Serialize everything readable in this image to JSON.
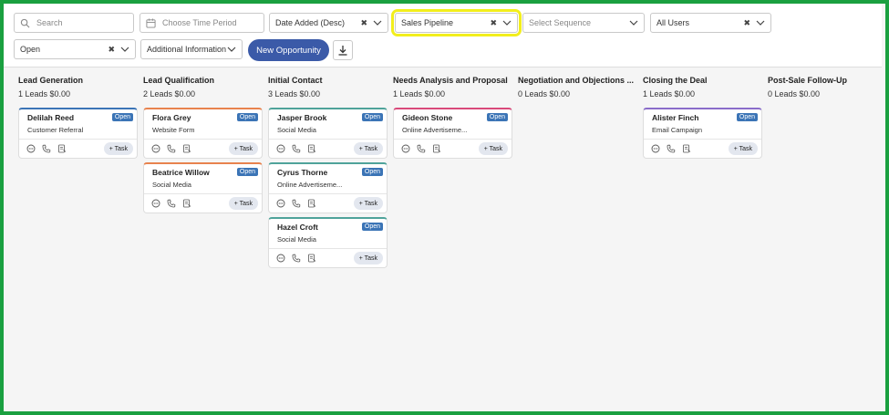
{
  "filters": {
    "search_placeholder": "Search",
    "time_period_placeholder": "Choose Time Period",
    "sort_value": "Date Added (Desc)",
    "pipeline_value": "Sales Pipeline",
    "sequence_placeholder": "Select Sequence",
    "users_value": "All Users",
    "status_value": "Open",
    "additional_info": "Additional Information"
  },
  "actions": {
    "new_opportunity": "New Opportunity"
  },
  "columns": [
    {
      "title": "Lead Generation",
      "summary": "1 Leads $0.00",
      "cards": [
        {
          "name": "Delilah Reed",
          "source": "Customer Referral",
          "status": "Open",
          "task": "+ Task",
          "accent": "#3b74b6"
        }
      ]
    },
    {
      "title": "Lead Qualification",
      "summary": "2 Leads $0.00",
      "cards": [
        {
          "name": "Flora Grey",
          "source": "Website Form",
          "status": "Open",
          "task": "+ Task",
          "accent": "#e8834e"
        },
        {
          "name": "Beatrice Willow",
          "source": "Social Media",
          "status": "Open",
          "task": "+ Task",
          "accent": "#e8834e"
        }
      ]
    },
    {
      "title": "Initial Contact",
      "summary": "3 Leads $0.00",
      "cards": [
        {
          "name": "Jasper Brook",
          "source": "Social Media",
          "status": "Open",
          "task": "+ Task",
          "accent": "#4fa39a"
        },
        {
          "name": "Cyrus Thorne",
          "source": "Online Advertiseme...",
          "status": "Open",
          "task": "+ Task",
          "accent": "#4fa39a"
        },
        {
          "name": "Hazel Croft",
          "source": "Social Media",
          "status": "Open",
          "task": "+ Task",
          "accent": "#4fa39a"
        }
      ]
    },
    {
      "title": "Needs Analysis and Proposal",
      "summary": "1 Leads $0.00",
      "cards": [
        {
          "name": "Gideon Stone",
          "source": "Online Advertiseme...",
          "status": "Open",
          "task": "+ Task",
          "accent": "#d9497a"
        }
      ]
    },
    {
      "title": "Negotiation and Objections ...",
      "summary": "0 Leads $0.00",
      "cards": []
    },
    {
      "title": "Closing the Deal",
      "summary": "1 Leads $0.00",
      "cards": [
        {
          "name": "Alister Finch",
          "source": "Email Campaign",
          "status": "Open",
          "task": "+ Task",
          "accent": "#8a6cc9"
        }
      ]
    },
    {
      "title": "Post-Sale Follow-Up",
      "summary": "0 Leads $0.00",
      "cards": []
    }
  ]
}
